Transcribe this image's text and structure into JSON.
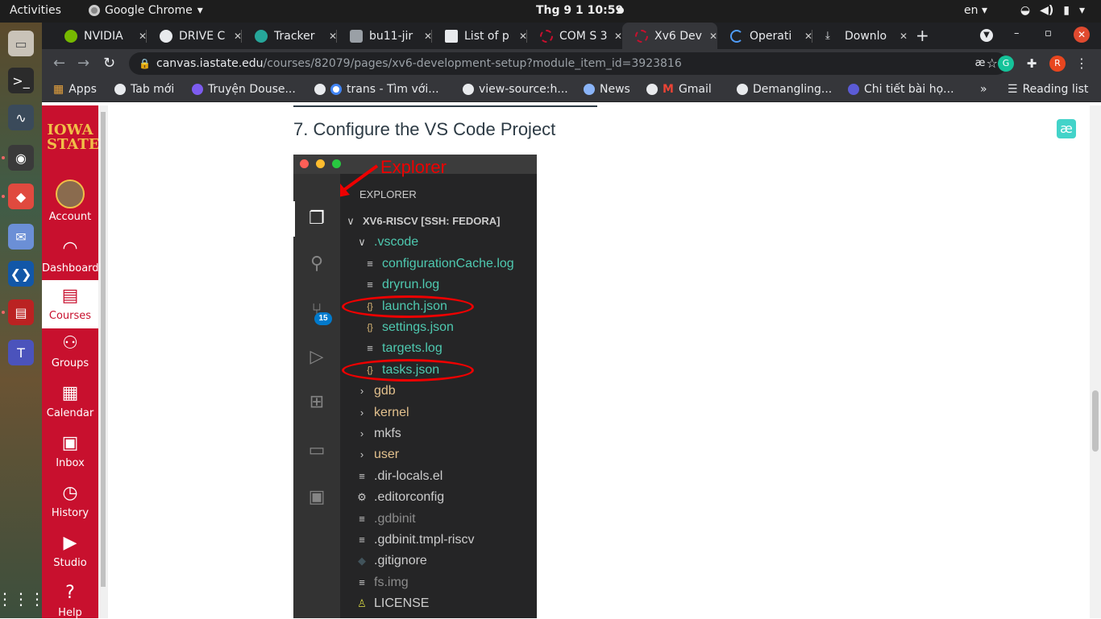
{
  "system": {
    "activities": "Activities",
    "app_name": "Google Chrome",
    "clock": "Thg 9 1  10:59",
    "language": "en"
  },
  "tabs": [
    {
      "title": "NVIDIA",
      "color": "#76b900"
    },
    {
      "title": "DRIVE C",
      "color": "#e8eaed"
    },
    {
      "title": "Tracker",
      "color": "#26a69a"
    },
    {
      "title": "bu11-jir",
      "color": "#9aa0a6"
    },
    {
      "title": "List of p",
      "color": "#e8eaed"
    },
    {
      "title": "COM S 3",
      "color": "#c8102e"
    },
    {
      "title": "Xv6 Dev",
      "color": "#c8102e"
    },
    {
      "title": "Operati",
      "color": "#4f9cf7"
    },
    {
      "title": "Downlo",
      "color": "#e8eaed"
    }
  ],
  "address": {
    "host": "canvas.iastate.edu",
    "path": "/courses/82079/pages/xv6-development-setup?module_item_id=3923816"
  },
  "bookmarks": [
    {
      "label": "Apps"
    },
    {
      "label": "Tab mới"
    },
    {
      "label": "Truyện Douse..."
    },
    {
      "label": "trans - Tìm với..."
    },
    {
      "label": "view-source:h..."
    },
    {
      "label": "News"
    },
    {
      "label": "Gmail"
    },
    {
      "label": "Demangling..."
    },
    {
      "label": "Chi tiết bài họ..."
    }
  ],
  "bookmarks_overflow": "»",
  "reading_list": "Reading list",
  "canvas_nav": {
    "logo_line1": "IOWA",
    "logo_line2": "STATE",
    "items": [
      {
        "label": "Account"
      },
      {
        "label": "Dashboard"
      },
      {
        "label": "Courses"
      },
      {
        "label": "Groups"
      },
      {
        "label": "Calendar"
      },
      {
        "label": "Inbox"
      },
      {
        "label": "History"
      },
      {
        "label": "Studio"
      },
      {
        "label": "Help"
      }
    ]
  },
  "page": {
    "heading": "7. Configure the VS Code Project",
    "reader_button": "æ"
  },
  "vscode": {
    "annotation": "Explorer",
    "explorer_title": "EXPLORER",
    "scm_badge": "15",
    "tree": [
      {
        "label": "XV6-RISCV [SSH: FEDORA]",
        "kind": "root",
        "color": "#cccccc"
      },
      {
        "label": ".vscode",
        "kind": "folder-open",
        "color": "#4ec9b0"
      },
      {
        "label": "configurationCache.log",
        "kind": "file",
        "color": "#4ec9b0"
      },
      {
        "label": "dryrun.log",
        "kind": "file",
        "color": "#4ec9b0"
      },
      {
        "label": "launch.json",
        "kind": "json",
        "color": "#4ec9b0"
      },
      {
        "label": "settings.json",
        "kind": "json",
        "color": "#4ec9b0"
      },
      {
        "label": "targets.log",
        "kind": "file",
        "color": "#4ec9b0"
      },
      {
        "label": "tasks.json",
        "kind": "json",
        "color": "#4ec9b0"
      },
      {
        "label": "gdb",
        "kind": "folder",
        "color": "#e2c08d"
      },
      {
        "label": "kernel",
        "kind": "folder",
        "color": "#e2c08d"
      },
      {
        "label": "mkfs",
        "kind": "folder",
        "color": "#cccccc"
      },
      {
        "label": "user",
        "kind": "folder",
        "color": "#e2c08d"
      },
      {
        "label": ".dir-locals.el",
        "kind": "file",
        "color": "#cccccc"
      },
      {
        "label": ".editorconfig",
        "kind": "gear",
        "color": "#cccccc"
      },
      {
        "label": ".gdbinit",
        "kind": "file",
        "color": "#8c8c8c"
      },
      {
        "label": ".gdbinit.tmpl-riscv",
        "kind": "file",
        "color": "#cccccc"
      },
      {
        "label": ".gitignore",
        "kind": "git",
        "color": "#cccccc"
      },
      {
        "label": "fs.img",
        "kind": "file",
        "color": "#8c8c8c"
      },
      {
        "label": "LICENSE",
        "kind": "license",
        "color": "#cccccc"
      }
    ]
  }
}
